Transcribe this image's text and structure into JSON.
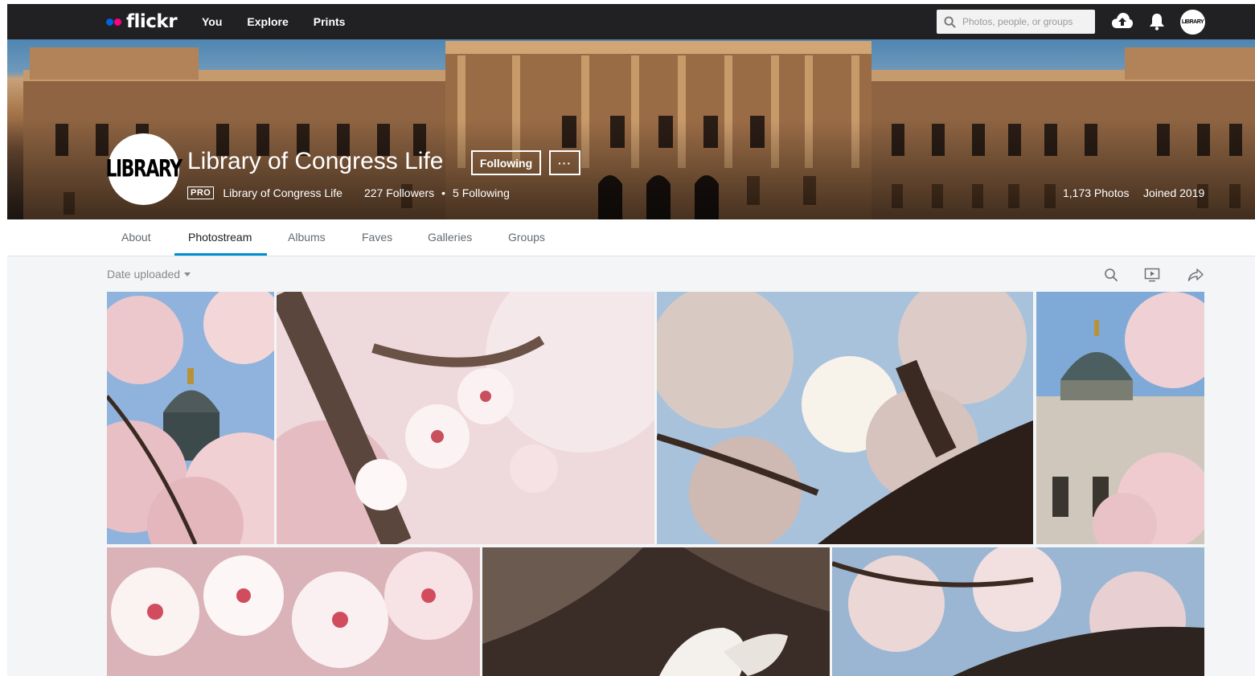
{
  "nav": {
    "logo_text": "flickr",
    "links": [
      "You",
      "Explore",
      "Prints"
    ],
    "search_placeholder": "Photos, people, or groups",
    "avatar_text": "LIBRARY"
  },
  "profile": {
    "avatar_text": "LIBRARY",
    "name": "Library of Congress Life",
    "follow_label": "Following",
    "more_label": "···",
    "pro_badge": "PRO",
    "username": "Library of Congress Life",
    "followers": "227 Followers",
    "separator": "•",
    "following": "5 Following",
    "photos_count": "1,173 Photos",
    "joined": "Joined 2019"
  },
  "tabs": [
    "About",
    "Photostream",
    "Albums",
    "Faves",
    "Galleries",
    "Groups"
  ],
  "active_tab": "Photostream",
  "toolbar": {
    "sort_label": "Date uploaded",
    "icons": [
      "search-icon",
      "slideshow-icon",
      "share-icon"
    ]
  },
  "colors": {
    "nav_bg": "#212124",
    "accent": "#008ecf",
    "logo_blue": "#0063dc",
    "logo_pink": "#ff0084"
  }
}
